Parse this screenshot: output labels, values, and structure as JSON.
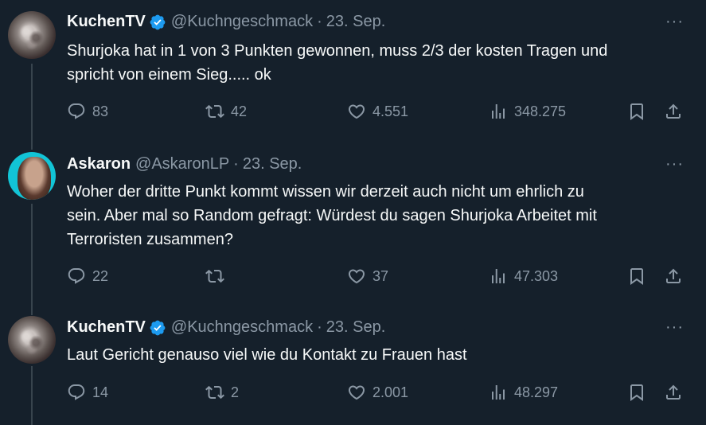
{
  "tweets": [
    {
      "name": "KuchenTV",
      "verified": true,
      "handle": "@Kuchngeschmack",
      "dot": "·",
      "date": "23. Sep.",
      "more": "···",
      "text_lines": [
        "Shurjoka hat in 1 von 3 Punkten gewonnen, muss 2/3 der kosten Tragen und",
        "spricht von einem Sieg..... ok"
      ],
      "replies": "83",
      "retweets": "42",
      "likes": "4.551",
      "views": "348.275"
    },
    {
      "name": "Askaron",
      "verified": false,
      "handle": "@AskaronLP",
      "dot": "·",
      "date": "23. Sep.",
      "more": "···",
      "text_lines": [
        "Woher der dritte Punkt kommt wissen wir derzeit auch nicht um ehrlich zu",
        "sein. Aber mal so Random gefragt: Würdest du sagen Shurjoka Arbeitet mit",
        "Terroristen zusammen?"
      ],
      "replies": "22",
      "retweets": "",
      "likes": "37",
      "views": "47.303"
    },
    {
      "name": "KuchenTV",
      "verified": true,
      "handle": "@Kuchngeschmack",
      "dot": "·",
      "date": "23. Sep.",
      "more": "···",
      "text_lines": [
        "Laut Gericht genauso viel wie du Kontakt zu Frauen hast"
      ],
      "replies": "14",
      "retweets": "2",
      "likes": "2.001",
      "views": "48.297"
    }
  ],
  "icons": {
    "reply": "reply-icon",
    "retweet": "retweet-icon",
    "like": "heart-icon",
    "views": "analytics-icon",
    "bookmark": "bookmark-icon",
    "share": "share-icon",
    "verified": "verified-badge-icon"
  },
  "colors": {
    "background": "#15202b",
    "text": "#f7f9f9",
    "muted": "#8b98a5",
    "verified": "#1d9bf0",
    "thread_line": "#38444d"
  }
}
